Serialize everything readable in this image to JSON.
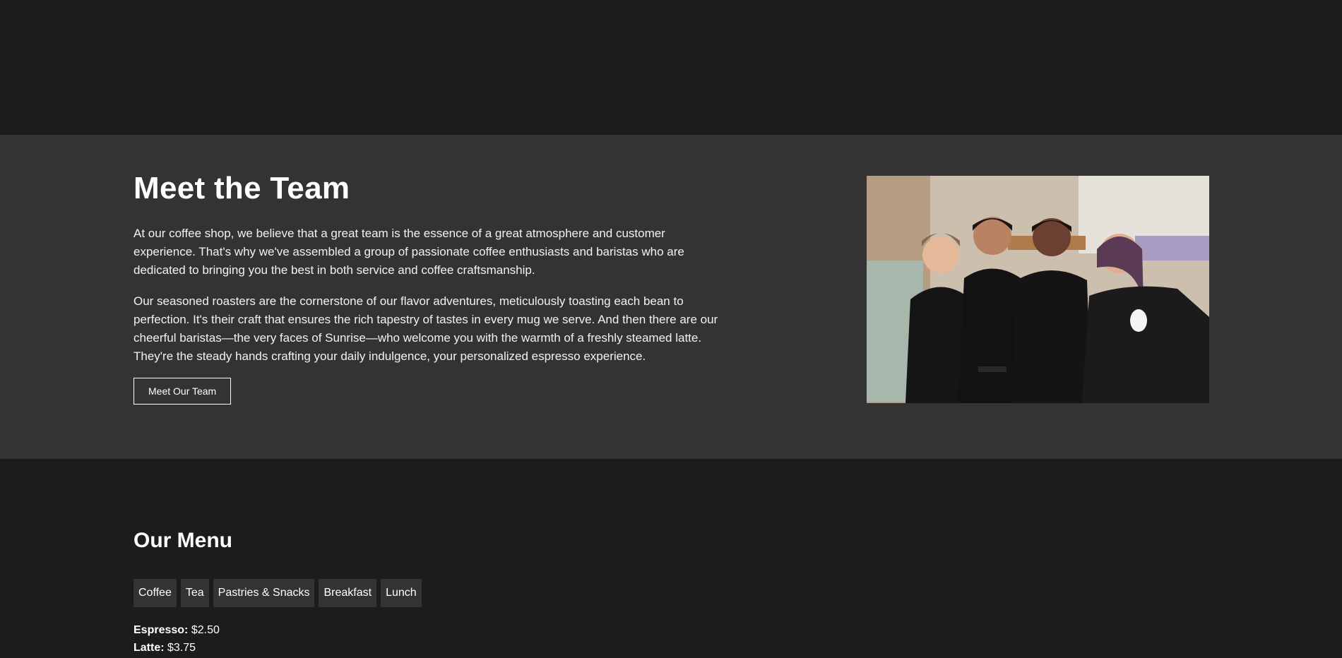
{
  "team": {
    "title": "Meet the Team",
    "paragraph1": "At our coffee shop, we believe that a great team is the essence of a great atmosphere and customer experience. That's why we've assembled a group of passionate coffee enthusiasts and baristas who are dedicated to bringing you the best in both service and coffee craftsmanship.",
    "paragraph2": "Our seasoned roasters are the cornerstone of our flavor adventures, meticulously toasting each bean to perfection. It's their craft that ensures the rich tapestry of tastes in every mug we serve. And then there are our cheerful baristas—the very faces of Sunrise—who welcome you with the warmth of a freshly steamed latte. They're the steady hands crafting your daily indulgence, your personalized espresso experience.",
    "button_label": "Meet Our Team"
  },
  "menu": {
    "title": "Our Menu",
    "tabs": [
      "Coffee",
      "Tea",
      "Pastries & Snacks",
      "Breakfast",
      "Lunch"
    ],
    "items": [
      {
        "name": "Espresso:",
        "price": "$2.50"
      },
      {
        "name": "Latte:",
        "price": "$3.75"
      }
    ]
  },
  "colors": {
    "page_bg": "#1c1c1c",
    "team_section_bg": "#333333",
    "tab_bg": "#333333",
    "text": "#ffffff"
  }
}
